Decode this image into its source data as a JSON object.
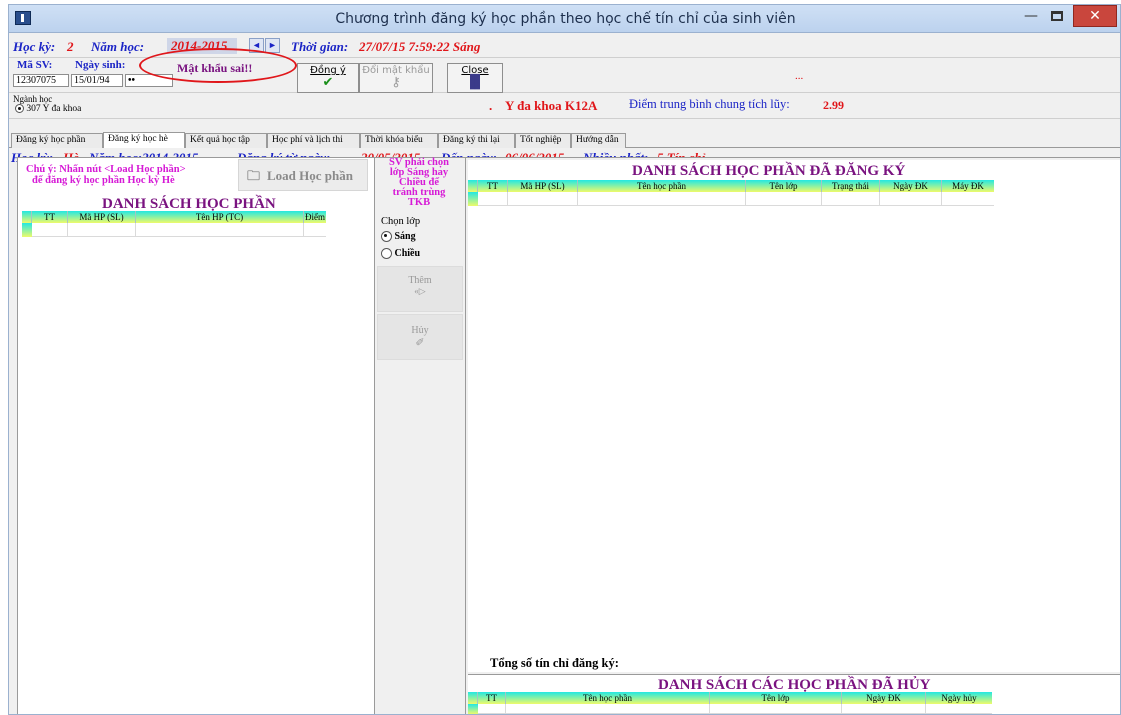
{
  "window": {
    "title": "Chương trình đăng ký học phần theo học chế tín chỉ của sinh viên",
    "min_glyph": "—",
    "close_glyph": "✕"
  },
  "term_bar": {
    "hoc_ky_label": "Học kỳ:",
    "hoc_ky_value": "2",
    "nam_hoc_label": "Năm học:",
    "nam_hoc_value": "2014-2015",
    "prev_glyph": "◄",
    "next_glyph": "►",
    "thoi_gian_label": "Thời gian:",
    "thoi_gian_value": "27/07/15 7:59:22 Sáng"
  },
  "login": {
    "ma_sv_label": "Mã SV:",
    "ma_sv_value": "12307075",
    "ngay_sinh_label": "Ngày sinh:",
    "ngay_sinh_value": "15/01/94",
    "password_value": "••",
    "error_message": "Mật khẩu sai!!",
    "ellipsis": "..."
  },
  "toolbar": {
    "dong_y_label": "Đồng ý",
    "doi_mat_khau_label": "Đổi mật khẩu",
    "close_label": "Close"
  },
  "student": {
    "nganh_hoc_label": "Ngành học",
    "nganh_hoc_value": "307 Y đa khoa",
    "name": "",
    "class_prefix": ".",
    "class_name": "Y đa khoa K12A",
    "gpa_label": "Điểm trung bình chung tích lũy:",
    "gpa_value": "2.99"
  },
  "tabs": [
    {
      "label": "Đăng ký học phần"
    },
    {
      "label": "Đăng ký học hè"
    },
    {
      "label": "Kết quả học tập"
    },
    {
      "label": "Học phí và lịch thi"
    },
    {
      "label": "Thời khóa biểu"
    },
    {
      "label": "Đăng ký thi lại"
    },
    {
      "label": "Tốt nghiệp"
    },
    {
      "label": "Hướng dẫn"
    }
  ],
  "summer_info": {
    "hoc_ky_label": "Học kỳ:",
    "hoc_ky_value": "Hè",
    "nam_hoc": "Năm học:2014-2015",
    "tu_ngay_label": "Đăng ký từ ngày:",
    "tu_ngay_value": "20/05/2015",
    "den_ngay_label": "Đến ngày:",
    "den_ngay_value": "06/06/2015",
    "nhieu_nhat_label": "Nhiều nhất:",
    "nhieu_nhat_value": "5 Tín chỉ."
  },
  "left_panel": {
    "note_line1": "Chú ý: Nhấn nút <Load Học phần>",
    "note_line2": "để đăng ký học phần Học kỳ Hè",
    "load_button": "Load Học phần",
    "title": "DANH SÁCH HỌC PHẦN",
    "columns": [
      "TT",
      "Mã HP (SL)",
      "Tên HP (TC)",
      "Điểm"
    ]
  },
  "mid_panel": {
    "note_lines": [
      "SV phải chọn",
      "lớp Sáng hay",
      "Chiều để",
      "tránh trùng",
      "TKB"
    ],
    "chon_lop_label": "Chọn lớp",
    "option_sang": "Sáng",
    "option_chieu": "Chiều",
    "them_label": "Thêm",
    "them_icon": "«▷",
    "huy_label": "Hủy",
    "huy_icon": "✐"
  },
  "registered": {
    "title": "DANH SÁCH HỌC PHẦN ĐÃ ĐĂNG KÝ",
    "columns": [
      "TT",
      "Mã HP (SL)",
      "Tên học phần",
      "Tên lớp",
      "Trạng thái",
      "Ngày ĐK",
      "Máy ĐK"
    ],
    "total_label": "Tổng số tín chỉ đăng ký:"
  },
  "cancelled": {
    "title": "DANH SÁCH CÁC HỌC PHẦN ĐÃ HỦY",
    "columns": [
      "TT",
      "Tên học phần",
      "Tên lớp",
      "Ngày ĐK",
      "Ngày hủy"
    ]
  }
}
